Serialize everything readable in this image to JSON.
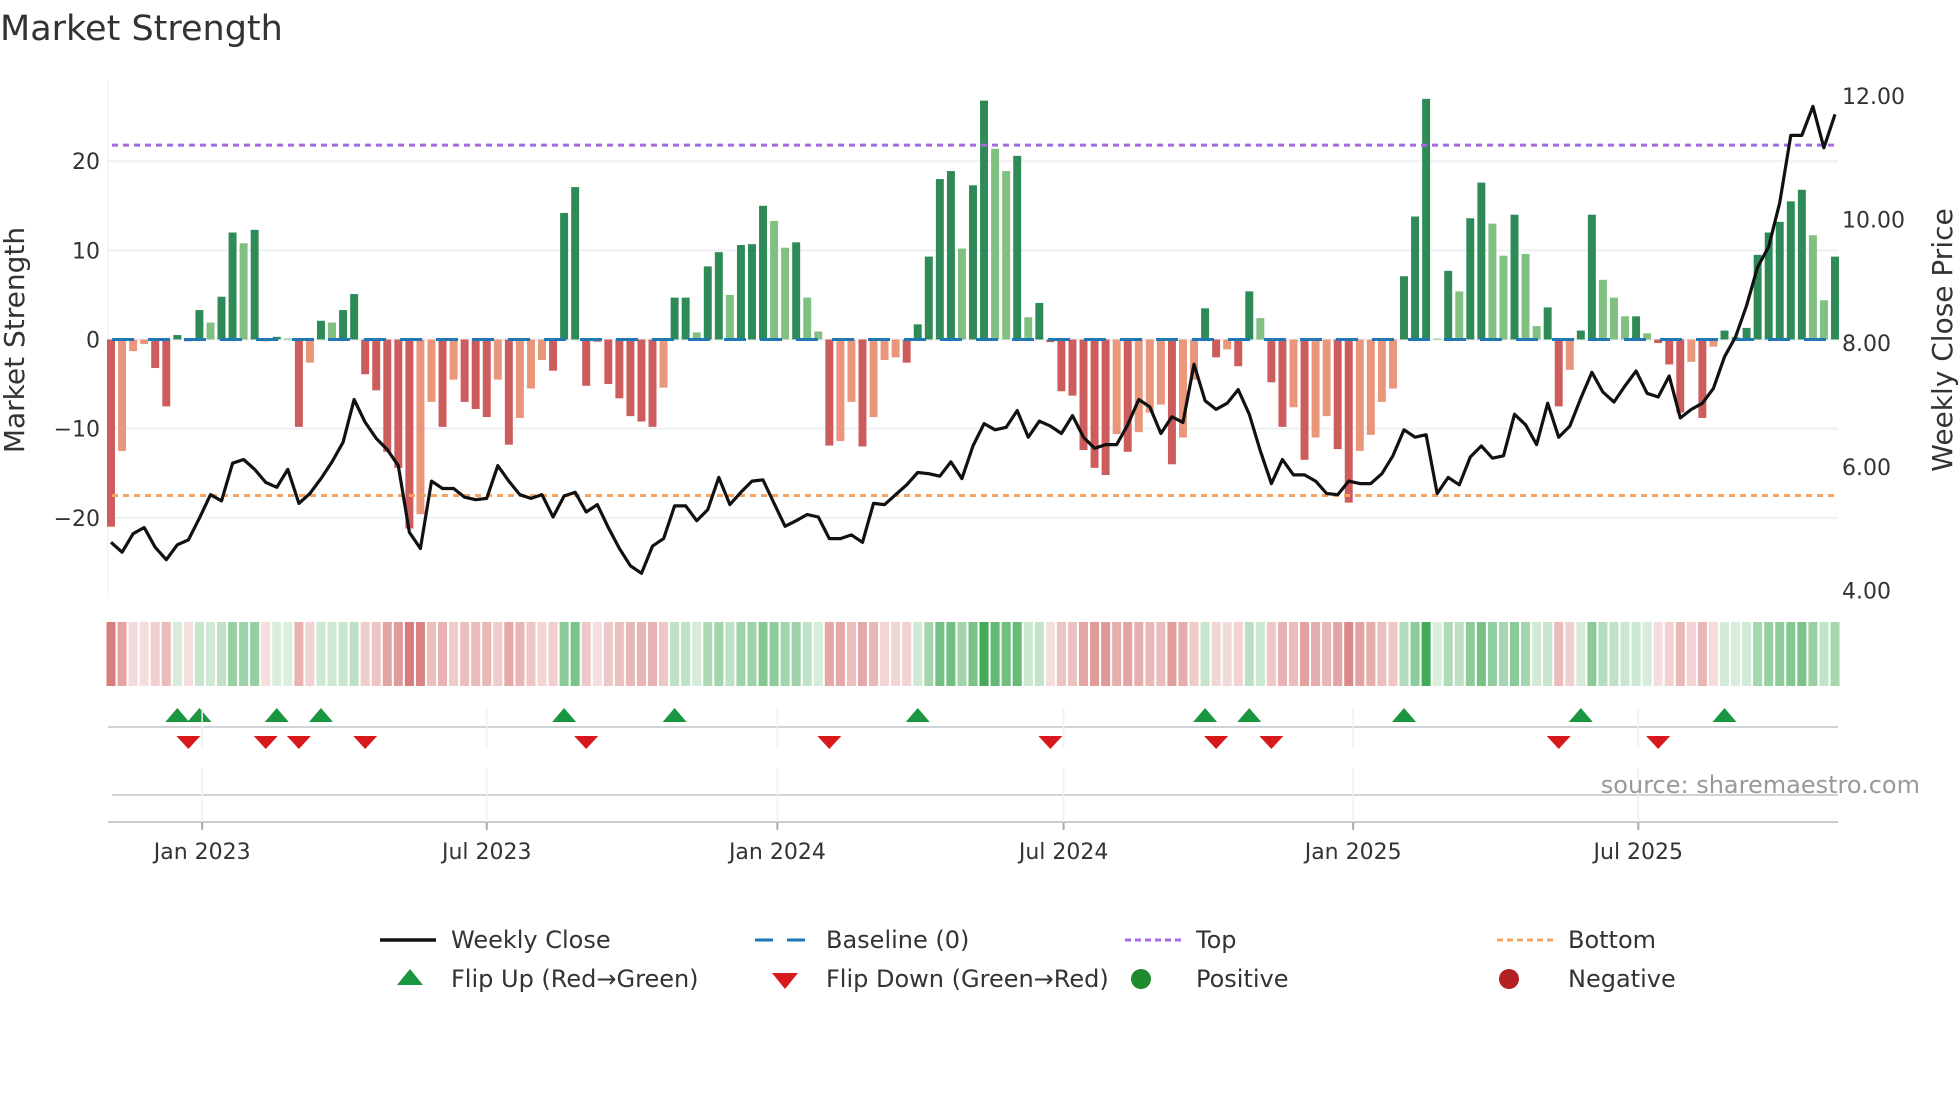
{
  "title": "Market Strength",
  "source": "source: sharemaestro.com",
  "chart_data": {
    "type": "bar",
    "title": "Market Strength",
    "ylabel": "Market Strength",
    "y2label": "Weekly Close Price",
    "ylim": [
      -29,
      29
    ],
    "y2lim": [
      3.88,
      12.24
    ],
    "yticks": [
      {
        "v": 20,
        "label": "20"
      },
      {
        "v": 10,
        "label": "10"
      },
      {
        "v": 0,
        "label": "0"
      },
      {
        "v": -10,
        "label": "−10"
      },
      {
        "v": -20,
        "label": "−20"
      }
    ],
    "y2ticks": [
      {
        "v": 12,
        "label": "12.00"
      },
      {
        "v": 10,
        "label": "10.00"
      },
      {
        "v": 8,
        "label": "8.00"
      },
      {
        "v": 6,
        "label": "6.00"
      },
      {
        "v": 4,
        "label": "4.00"
      }
    ],
    "xticks": [
      {
        "week": 8.25,
        "label": "Jan 2023"
      },
      {
        "week": 34.0,
        "label": "Jul 2023"
      },
      {
        "week": 60.3,
        "label": "Jan 2024"
      },
      {
        "week": 86.2,
        "label": "Jul 2024"
      },
      {
        "week": 112.4,
        "label": "Jan 2025"
      },
      {
        "week": 138.2,
        "label": "Jul 2025"
      }
    ],
    "top_level": 21.8,
    "bottom_level": -17.5,
    "baseline": 0,
    "strength": [
      -21,
      -12.5,
      -1.3,
      -0.5,
      -3.2,
      -7.5,
      0.5,
      -0.2,
      3.3,
      1.9,
      4.8,
      12,
      10.8,
      12.3,
      -0.2,
      0.3,
      0.1,
      -9.8,
      -2.6,
      2.1,
      1.9,
      3.3,
      5.1,
      -3.9,
      -5.7,
      -12.6,
      -14.4,
      -21.2,
      -19.6,
      -7,
      -9.8,
      -4.5,
      -7,
      -7.8,
      -8.7,
      -4.5,
      -11.8,
      -8.8,
      -5.5,
      -2.3,
      -3.5,
      14.2,
      17.1,
      -5.2,
      -0.3,
      -5,
      -6.6,
      -8.6,
      -9.2,
      -9.8,
      -5.4,
      4.7,
      4.7,
      0.8,
      8.2,
      9.8,
      5,
      10.6,
      10.7,
      15,
      13.3,
      10.3,
      10.9,
      4.7,
      0.9,
      -11.9,
      -11.4,
      -7,
      -12,
      -8.7,
      -2.3,
      -2,
      -2.6,
      1.7,
      9.3,
      18,
      18.9,
      10.2,
      17.3,
      26.8,
      21.4,
      18.9,
      20.6,
      2.5,
      4.1,
      -0.3,
      -5.8,
      -6.3,
      -12.4,
      -14.4,
      -15.2,
      -10.6,
      -12.6,
      -10.4,
      -8.2,
      -7.3,
      -14,
      -11,
      -4.5,
      3.5,
      -2,
      -1.1,
      -3,
      5.4,
      2.4,
      -4.8,
      -9.8,
      -7.6,
      -13.5,
      -11,
      -8.6,
      -12.3,
      -18.3,
      -12.5,
      -10.7,
      -7,
      -5.5,
      7.1,
      13.8,
      27,
      0.1,
      7.7,
      5.4,
      13.6,
      17.6,
      13,
      9.4,
      14,
      9.6,
      1.5,
      3.6,
      -7.5,
      -3.4,
      1,
      14,
      6.7,
      4.7,
      2.6,
      2.6,
      0.7,
      -0.4,
      -2.8,
      -8.2,
      -2.5,
      -8.8,
      -0.8,
      1,
      0.3,
      1.3,
      9.5,
      12,
      13.2,
      15.5,
      16.8,
      11.7,
      4.4,
      9.3
    ],
    "weekly_close": [
      4.78,
      4.62,
      4.92,
      5.02,
      4.7,
      4.5,
      4.74,
      4.82,
      5.17,
      5.55,
      5.45,
      6.06,
      6.12,
      5.96,
      5.75,
      5.67,
      5.96,
      5.41,
      5.57,
      5.81,
      6.08,
      6.4,
      7.09,
      6.72,
      6.46,
      6.28,
      6.02,
      4.94,
      4.68,
      5.77,
      5.65,
      5.65,
      5.51,
      5.47,
      5.49,
      6.02,
      5.77,
      5.55,
      5.49,
      5.55,
      5.19,
      5.53,
      5.59,
      5.27,
      5.39,
      5.02,
      4.68,
      4.4,
      4.28,
      4.72,
      4.84,
      5.37,
      5.37,
      5.13,
      5.31,
      5.83,
      5.39,
      5.59,
      5.77,
      5.79,
      5.41,
      5.04,
      5.13,
      5.23,
      5.19,
      4.84,
      4.84,
      4.9,
      4.78,
      5.41,
      5.39,
      5.55,
      5.71,
      5.91,
      5.89,
      5.85,
      6.08,
      5.81,
      6.34,
      6.7,
      6.6,
      6.64,
      6.91,
      6.48,
      6.74,
      6.66,
      6.54,
      6.83,
      6.48,
      6.3,
      6.36,
      6.36,
      6.68,
      7.09,
      6.97,
      6.54,
      6.81,
      6.72,
      7.66,
      7.07,
      6.93,
      7.03,
      7.25,
      6.85,
      6.26,
      5.73,
      6.12,
      5.87,
      5.87,
      5.77,
      5.57,
      5.55,
      5.77,
      5.73,
      5.73,
      5.89,
      6.18,
      6.6,
      6.48,
      6.52,
      5.57,
      5.83,
      5.71,
      6.16,
      6.34,
      6.14,
      6.18,
      6.85,
      6.68,
      6.36,
      7.03,
      6.48,
      6.66,
      7.11,
      7.53,
      7.21,
      7.05,
      7.31,
      7.55,
      7.19,
      7.13,
      7.47,
      6.79,
      6.93,
      7.03,
      7.27,
      7.78,
      8.1,
      8.61,
      9.23,
      9.56,
      10.27,
      11.36,
      11.36,
      11.83,
      11.16,
      11.7
    ],
    "colors": {
      "pos_rising": "#2e8b57",
      "pos_falling": "#80c080",
      "neg_falling": "#cd5c5c",
      "neg_rising": "#e9967a",
      "baseline": "#1f77b4",
      "top": "#a66be0",
      "bottom": "#f4a460",
      "close": "#111111",
      "flip_up": "#1a9641",
      "flip_down": "#d7191c"
    },
    "legend": {
      "position": "bottom",
      "items": [
        {
          "label": "Weekly Close",
          "symbol": "line"
        },
        {
          "label": "Baseline (0)",
          "symbol": "dash-blue"
        },
        {
          "label": "Top",
          "symbol": "dot-purple"
        },
        {
          "label": "Bottom",
          "symbol": "dot-orange"
        },
        {
          "label": "Flip Up (Red→Green)",
          "symbol": "tri-up"
        },
        {
          "label": "Flip Down (Green→Red)",
          "symbol": "tri-down"
        },
        {
          "label": "Positive",
          "symbol": "circle-green"
        },
        {
          "label": "Negative",
          "symbol": "circle-red"
        }
      ]
    }
  }
}
